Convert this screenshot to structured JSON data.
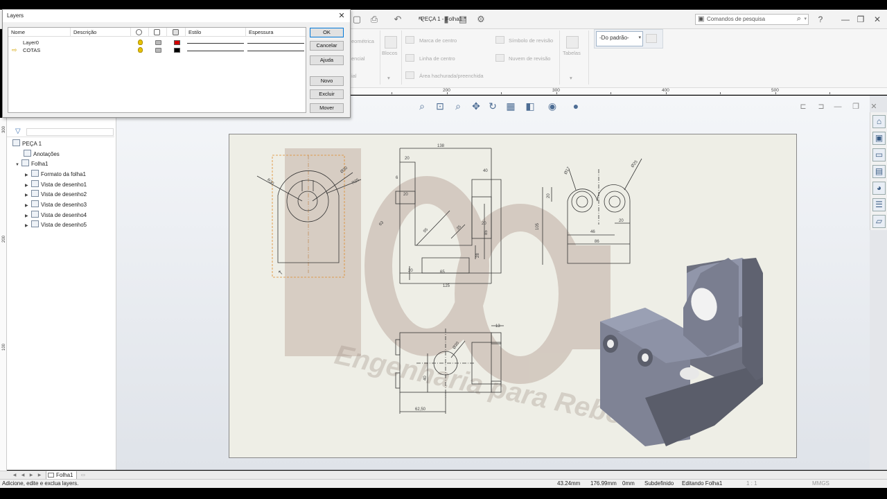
{
  "doc_title": "PEÇA 1 - Folha1 *",
  "search": {
    "placeholder": "Comandos de pesquisa"
  },
  "ribbon": {
    "geometrica": "eométrica",
    "encial": "encial",
    "ial": "ial",
    "blocos": "Blocos",
    "marca_centro": "Marca de centro",
    "linha_centro": "Linha de centro",
    "area_hachurada": "Área hachurada/preenchida",
    "simbolo_revisao": "Símbolo de revisão",
    "nuvem_revisao": "Nuvem de revisão",
    "tabelas": "Tabelas",
    "layer_select": "-Do padrão-"
  },
  "ruler_h": [
    "200",
    "300",
    "400",
    "500"
  ],
  "ruler_v": [
    "300",
    "200",
    "100"
  ],
  "tree": {
    "root": "PEÇA 1",
    "anotacoes": "Anotações",
    "folha": "Folha1",
    "children": [
      "Formato da folha1",
      "Vista de desenho1",
      "Vista de desenho2",
      "Vista de desenho3",
      "Vista de desenho4",
      "Vista de desenho5"
    ]
  },
  "drawing_dims": {
    "d138": "138",
    "d20a": "20",
    "d40": "40",
    "d6": "6",
    "d20b": "20",
    "d95": "95",
    "d20c": "20",
    "d85": "85",
    "d28": "28",
    "d65": "65",
    "d125": "125",
    "d20d": "20",
    "d63": "63",
    "d35": "35",
    "d105": "105",
    "d20e": "20",
    "d46": "46",
    "d86": "86",
    "d20f": "20",
    "d17": "Ø17",
    "d25a": "Ø25",
    "d40b": "40",
    "d62": "62,50",
    "d13": "13",
    "d20g": "Ø20",
    "r30": "R30",
    "r40": "Ø30",
    "r25": "R25"
  },
  "watermark": "Engenharia para Reboques",
  "sheet_tab": "Folha1",
  "status": {
    "message": "Adicione, edite e exclua layers.",
    "x": "43.24mm",
    "y": "176.99mm",
    "z": "0mm",
    "state": "Subdefinido",
    "editing": "Editando Folha1",
    "scale": "1 : 1",
    "units": "MMGS"
  },
  "dialog": {
    "title": "Layers",
    "columns": {
      "nome": "Nome",
      "descricao": "Descrição",
      "estilo": "Estilo",
      "espessura": "Espessura"
    },
    "layers": [
      {
        "name": "Layer0",
        "color": "#d40000"
      },
      {
        "name": "COTAS",
        "color": "#000000"
      }
    ],
    "buttons": {
      "ok": "OK",
      "cancelar": "Cancelar",
      "ajuda": "Ajuda",
      "novo": "Novo",
      "excluir": "Excluir",
      "mover": "Mover"
    }
  }
}
